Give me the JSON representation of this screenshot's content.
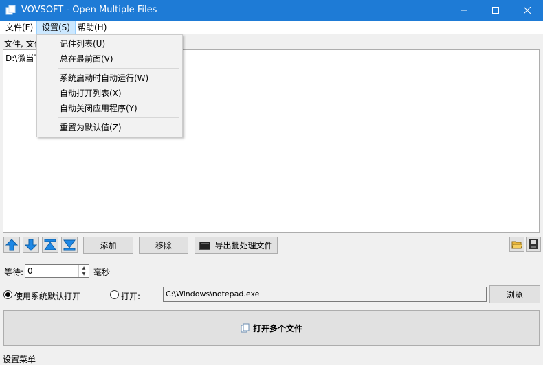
{
  "window": {
    "title": "VOVSOFT - Open Multiple Files"
  },
  "menubar": {
    "file": "文件(F)",
    "settings": "设置(S)",
    "help": "帮助(H)"
  },
  "settings_menu": {
    "remember_list": "记住列表(U)",
    "always_on_top": "总在最前面(V)",
    "run_at_startup": "系统启动时自动运行(W)",
    "auto_open_list": "自动打开列表(X)",
    "auto_close_apps": "自动关闭应用程序(Y)",
    "reset_defaults": "重置为默认值(Z)"
  },
  "file_list": {
    "label": "文件, 文件",
    "items": [
      "D:\\微当下"
    ]
  },
  "toolbar": {
    "add": "添加",
    "remove": "移除",
    "export_batch": "导出批处理文件"
  },
  "wait": {
    "label": "等待:",
    "value": "0",
    "unit": "毫秒"
  },
  "open_mode": {
    "default_label": "使用系统默认打开",
    "open_label": "打开:",
    "selected": "default",
    "program_path": "C:\\Windows\\notepad.exe",
    "browse": "浏览"
  },
  "open_button": "打开多个文件",
  "status": "设置菜单",
  "colors": {
    "titlebar": "#1e7bd6",
    "menu_highlight": "#cce8ff",
    "arrow_blue": "#1e88e5"
  }
}
